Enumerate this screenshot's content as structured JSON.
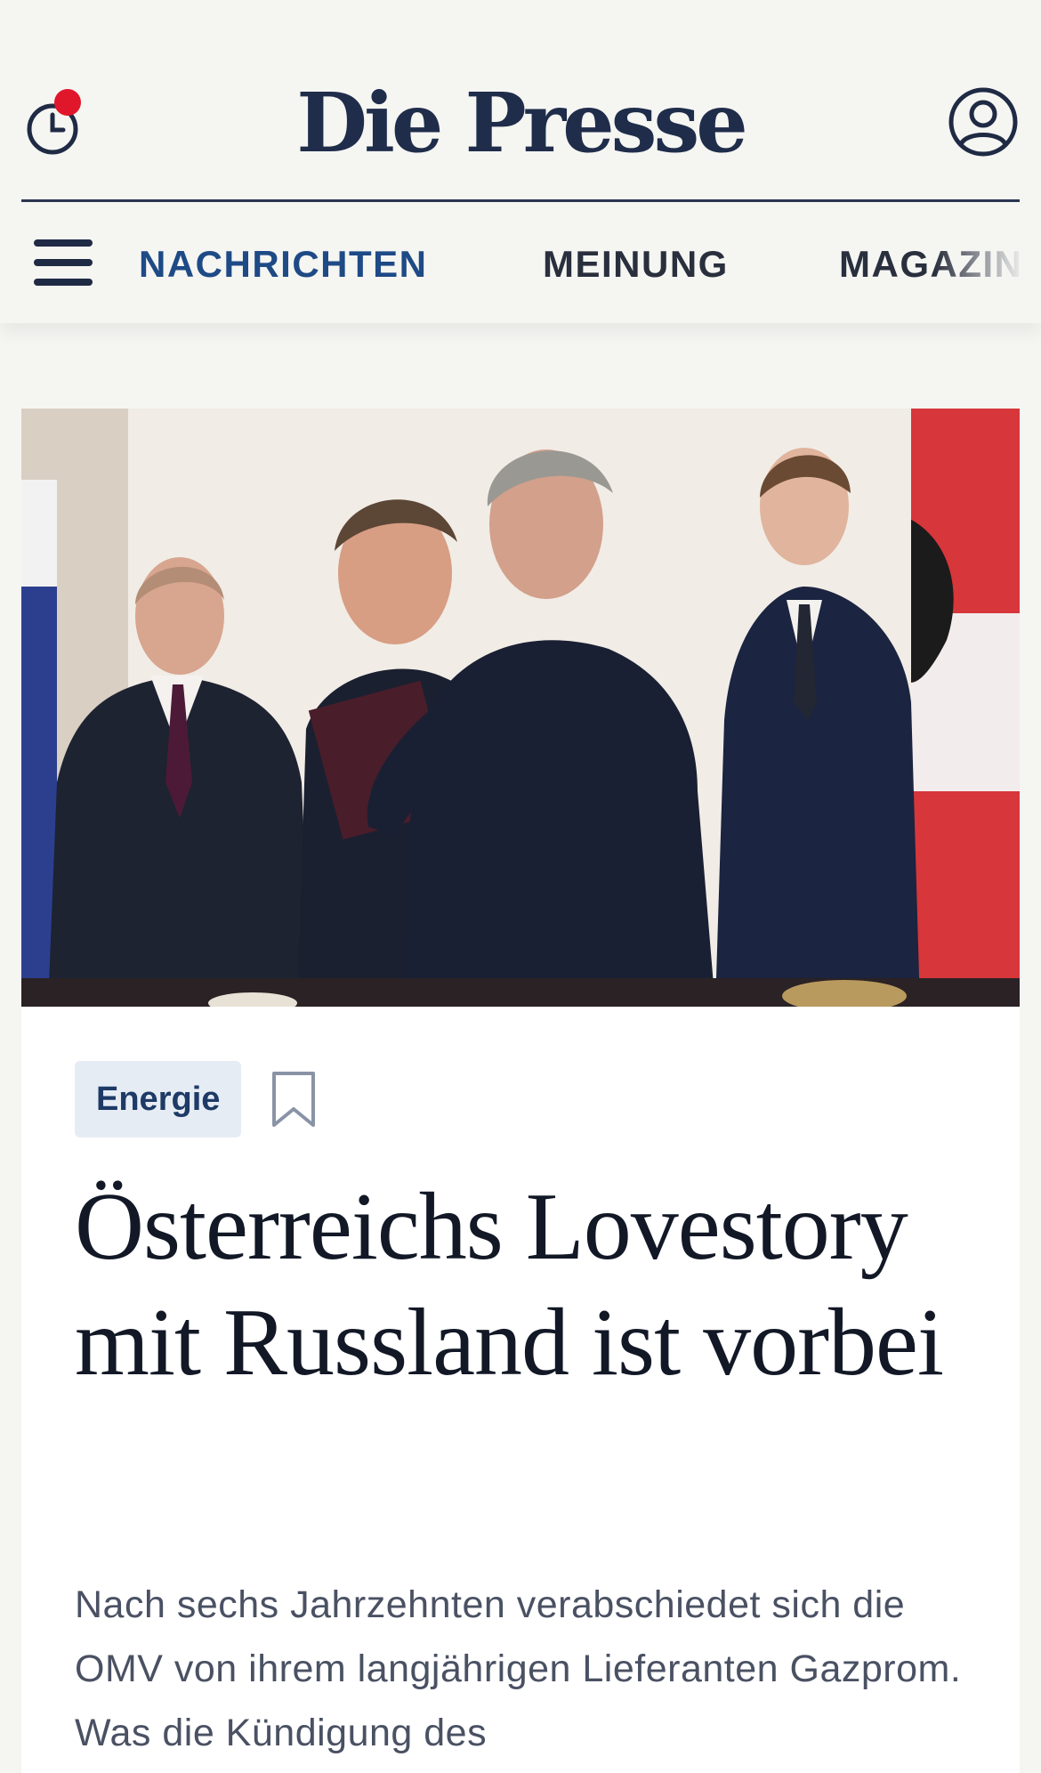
{
  "header": {
    "logo": "Die Presse",
    "history_icon": "clock-icon",
    "notification_dot": true,
    "account_icon": "user-icon"
  },
  "nav": {
    "menu_icon": "hamburger-icon",
    "items": [
      {
        "label": "NACHRICHTEN",
        "active": true
      },
      {
        "label": "MEINUNG",
        "active": false
      },
      {
        "label": "MAGAZIN",
        "active": false
      }
    ]
  },
  "article": {
    "category": "Energie",
    "bookmark_icon": "bookmark-icon",
    "headline": "Österreichs Lovestory mit Russland ist vorbei",
    "teaser": "Nach sechs Jahrzehnten verabschiedet sich die OMV von ihrem langjährigen Lieferanten Gazprom. Was die Kündigung des"
  },
  "colors": {
    "brand_navy": "#1f2d4b",
    "active_nav": "#1e4a86",
    "notification": "#e0162b",
    "tag_bg": "#e6ecf4"
  }
}
